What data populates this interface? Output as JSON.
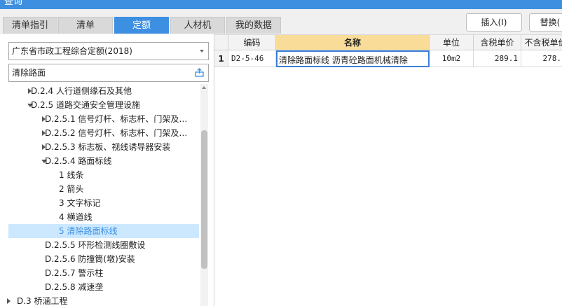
{
  "window": {
    "title": "查询"
  },
  "tabs": [
    {
      "label": "清单指引",
      "active": false
    },
    {
      "label": "清单",
      "active": false
    },
    {
      "label": "定额",
      "active": true
    },
    {
      "label": "人材机",
      "active": false
    },
    {
      "label": "我的数据",
      "active": false
    }
  ],
  "toolbar": {
    "insert_label": "插入(I)",
    "replace_label": "替换("
  },
  "left": {
    "quota_selector": {
      "value": "广东省市政工程综合定额(2018)"
    },
    "search": {
      "value": "清除路面",
      "icon": "person-up-icon"
    },
    "tree": [
      {
        "text": "D.2.4 人行道侧缘石及其他",
        "indent": 0,
        "arrow": "right"
      },
      {
        "text": "D.2.5 道路交通安全管理设施",
        "indent": 0,
        "arrow": "down"
      },
      {
        "text": "D.2.5.1 信号灯杆、标志杆、门架及…",
        "indent": 1,
        "arrow": "right"
      },
      {
        "text": "D.2.5.2 信号灯杆、标志杆、门架及…",
        "indent": 1,
        "arrow": "right"
      },
      {
        "text": "D.2.5.3 标志板、视线诱导器安装",
        "indent": 1,
        "arrow": "right"
      },
      {
        "text": "D.2.5.4 路面标线",
        "indent": 1,
        "arrow": "down"
      },
      {
        "text": "1 线条",
        "indent": 2,
        "arrow": ""
      },
      {
        "text": "2 箭头",
        "indent": 2,
        "arrow": ""
      },
      {
        "text": "3 文字标记",
        "indent": 2,
        "arrow": ""
      },
      {
        "text": "4 横道线",
        "indent": 2,
        "arrow": ""
      },
      {
        "text": "5 清除路面标线",
        "indent": 2,
        "arrow": "",
        "selected": true
      },
      {
        "text": "D.2.5.5 环形检测线圈敷设",
        "indent": 1,
        "arrow": ""
      },
      {
        "text": "D.2.5.6 防撞筒(墩)安装",
        "indent": 1,
        "arrow": ""
      },
      {
        "text": "D.2.5.7 警示柱",
        "indent": 1,
        "arrow": ""
      },
      {
        "text": "D.2.5.8 减速垄",
        "indent": 1,
        "arrow": ""
      },
      {
        "text": "D.3 桥涵工程",
        "indent": -1,
        "arrow": "right"
      }
    ]
  },
  "table": {
    "headers": [
      "",
      "编码",
      "名称",
      "单位",
      "含税单价",
      "不含税单价"
    ],
    "rows": [
      [
        "1",
        "D2-5-46",
        "清除路面标线 沥青砼路面机械清除",
        "10m2",
        "289.1",
        "278."
      ]
    ]
  },
  "colors": {
    "accent": "#3d8fe2",
    "header_highlight": "#f8dc98",
    "selected_row": "#cce8ff"
  }
}
